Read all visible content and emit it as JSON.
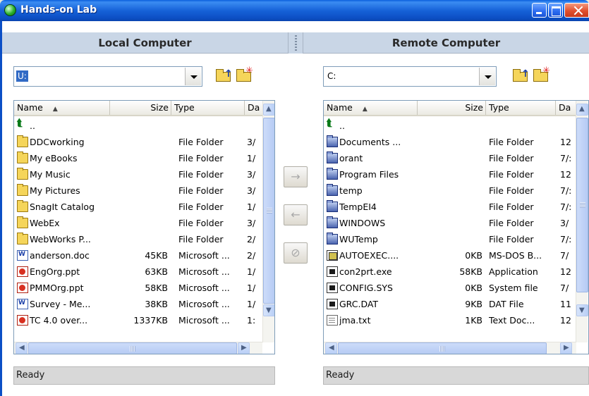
{
  "window": {
    "title": "Hands-on Lab",
    "accent": "#0b4fc6"
  },
  "panes": {
    "left": {
      "header": "Local Computer",
      "drive": "U:",
      "columns": [
        "Name",
        "Size",
        "Type",
        "Da"
      ],
      "rows": [
        {
          "icon": "parent-folder-icon",
          "name": "..",
          "size": "",
          "type": "",
          "date": ""
        },
        {
          "icon": "folder-icon",
          "name": "DDCworking",
          "size": "",
          "type": "File Folder",
          "date": "3/"
        },
        {
          "icon": "folder-icon",
          "name": "My eBooks",
          "size": "",
          "type": "File Folder",
          "date": "1/"
        },
        {
          "icon": "folder-icon",
          "name": "My Music",
          "size": "",
          "type": "File Folder",
          "date": "3/"
        },
        {
          "icon": "folder-icon",
          "name": "My Pictures",
          "size": "",
          "type": "File Folder",
          "date": "3/"
        },
        {
          "icon": "folder-icon",
          "name": "SnagIt Catalog",
          "size": "",
          "type": "File Folder",
          "date": "1/"
        },
        {
          "icon": "folder-icon",
          "name": "WebEx",
          "size": "",
          "type": "File Folder",
          "date": "3/"
        },
        {
          "icon": "folder-icon",
          "name": "WebWorks P...",
          "size": "",
          "type": "File Folder",
          "date": "2/"
        },
        {
          "icon": "word-doc-icon",
          "name": "anderson.doc",
          "size": "45KB",
          "type": "Microsoft ...",
          "date": "2/"
        },
        {
          "icon": "powerpoint-icon",
          "name": "EngOrg.ppt",
          "size": "63KB",
          "type": "Microsoft ...",
          "date": "1/"
        },
        {
          "icon": "powerpoint-icon",
          "name": "PMMOrg.ppt",
          "size": "58KB",
          "type": "Microsoft ...",
          "date": "1/"
        },
        {
          "icon": "word-doc-icon",
          "name": "Survey - Me...",
          "size": "38KB",
          "type": "Microsoft ...",
          "date": "1/"
        },
        {
          "icon": "powerpoint-icon",
          "name": "TC 4.0 over...",
          "size": "1337KB",
          "type": "Microsoft ...",
          "date": "1:"
        }
      ],
      "status": "Ready"
    },
    "right": {
      "header": "Remote Computer",
      "drive": "C:",
      "columns": [
        "Name",
        "Size",
        "Type",
        "Da"
      ],
      "rows": [
        {
          "icon": "parent-folder-icon",
          "name": "..",
          "size": "",
          "type": "",
          "date": ""
        },
        {
          "icon": "system-folder-icon",
          "name": "Documents ...",
          "size": "",
          "type": "File Folder",
          "date": "12"
        },
        {
          "icon": "system-folder-icon",
          "name": "orant",
          "size": "",
          "type": "File Folder",
          "date": "7/:"
        },
        {
          "icon": "system-folder-icon",
          "name": "Program Files",
          "size": "",
          "type": "File Folder",
          "date": "12"
        },
        {
          "icon": "system-folder-icon",
          "name": "temp",
          "size": "",
          "type": "File Folder",
          "date": "7/:"
        },
        {
          "icon": "system-folder-icon",
          "name": "TempEI4",
          "size": "",
          "type": "File Folder",
          "date": "7/:"
        },
        {
          "icon": "system-folder-icon",
          "name": "WINDOWS",
          "size": "",
          "type": "File Folder",
          "date": "3/"
        },
        {
          "icon": "system-folder-icon",
          "name": "WUTemp",
          "size": "",
          "type": "File Folder",
          "date": "7/:"
        },
        {
          "icon": "batch-file-icon",
          "name": "AUTOEXEC....",
          "size": "0KB",
          "type": "MS-DOS B...",
          "date": "7/"
        },
        {
          "icon": "executable-icon",
          "name": "con2prt.exe",
          "size": "58KB",
          "type": "Application",
          "date": "12"
        },
        {
          "icon": "executable-icon",
          "name": "CONFIG.SYS",
          "size": "0KB",
          "type": "System file",
          "date": "7/"
        },
        {
          "icon": "executable-icon",
          "name": "GRC.DAT",
          "size": "9KB",
          "type": "DAT File",
          "date": "11"
        },
        {
          "icon": "text-file-icon",
          "name": "jma.txt",
          "size": "1KB",
          "type": "Text Doc...",
          "date": "12"
        }
      ],
      "status": "Ready"
    }
  },
  "transfer": {
    "upload_glyph": "→",
    "download_glyph": "←",
    "stop_glyph": "⊘"
  },
  "icons": {
    "up_folder": "up-folder-icon",
    "new_folder": "new-folder-icon"
  }
}
